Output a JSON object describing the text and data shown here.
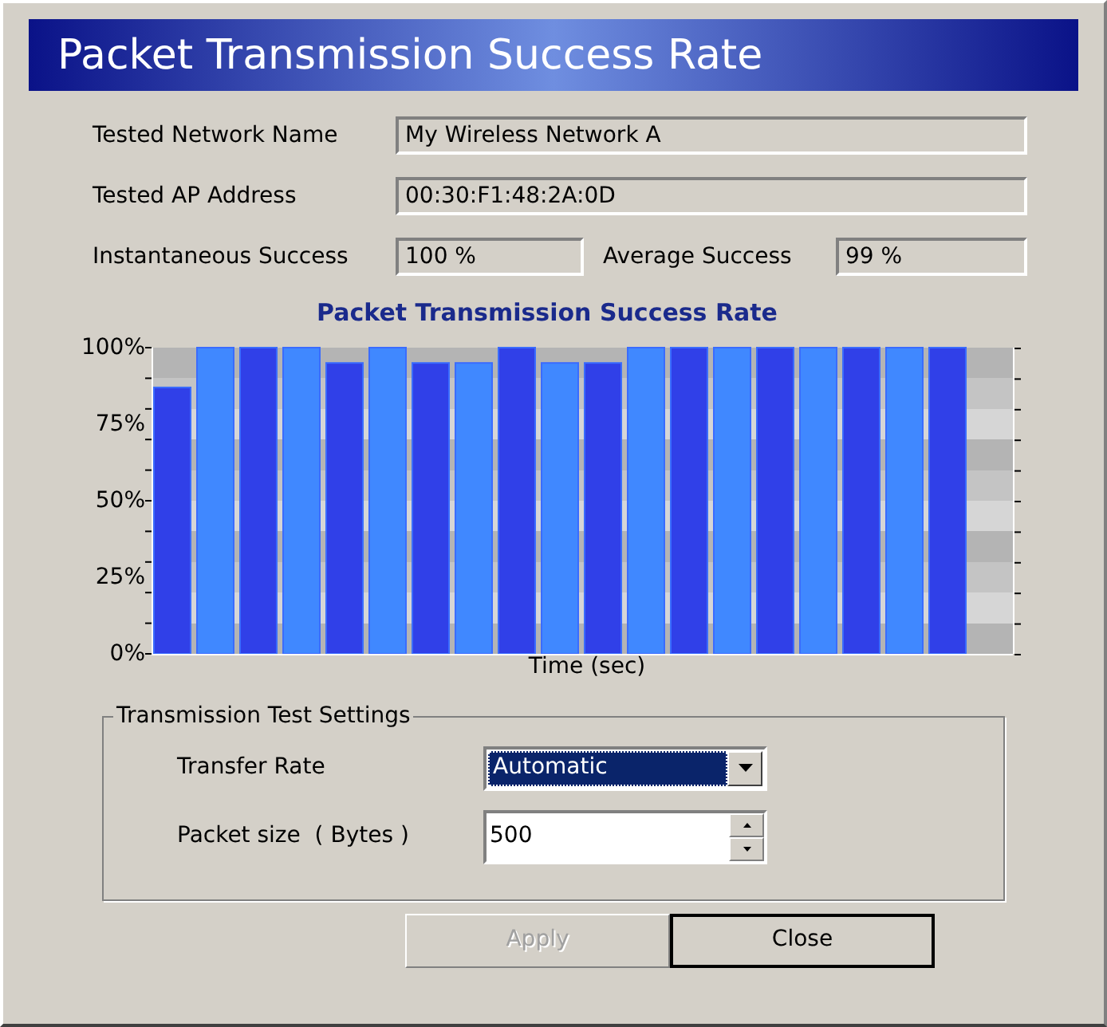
{
  "header": {
    "title": "Packet Transmission Success Rate"
  },
  "info": {
    "network_name": {
      "label": "Tested Network Name",
      "value": "My Wireless Network A"
    },
    "ap_address": {
      "label": "Tested AP Address",
      "value": "00:30:F1:48:2A:0D"
    },
    "instantaneous": {
      "label": "Instantaneous Success",
      "value": "100 %"
    },
    "average": {
      "label": "Average Success",
      "value": "99 %"
    }
  },
  "chart": {
    "chart_data": {
      "type": "bar",
      "title": "Packet Transmission Success Rate",
      "xlabel": "Time (sec)",
      "values": [
        87,
        100,
        100,
        100,
        95,
        100,
        95,
        95,
        100,
        95,
        95,
        100,
        100,
        100,
        100,
        100,
        100,
        100,
        100,
        null
      ],
      "ylim": [
        0,
        100
      ],
      "yticks": [
        {
          "value": 0,
          "label": "0%"
        },
        {
          "value": 25,
          "label": "25%"
        },
        {
          "value": 50,
          "label": "50%"
        },
        {
          "value": 75,
          "label": "75%"
        },
        {
          "value": 100,
          "label": "100%"
        }
      ]
    }
  },
  "settings": {
    "title": "Transmission Test Settings",
    "transfer_rate": {
      "label": "Transfer Rate",
      "value": "Automatic"
    },
    "packet_size": {
      "label": "Packet size  ( Bytes )",
      "value": "500"
    }
  },
  "buttons": [
    {
      "label": "Apply",
      "disabled": true
    },
    {
      "label": "Close",
      "disabled": false
    }
  ]
}
